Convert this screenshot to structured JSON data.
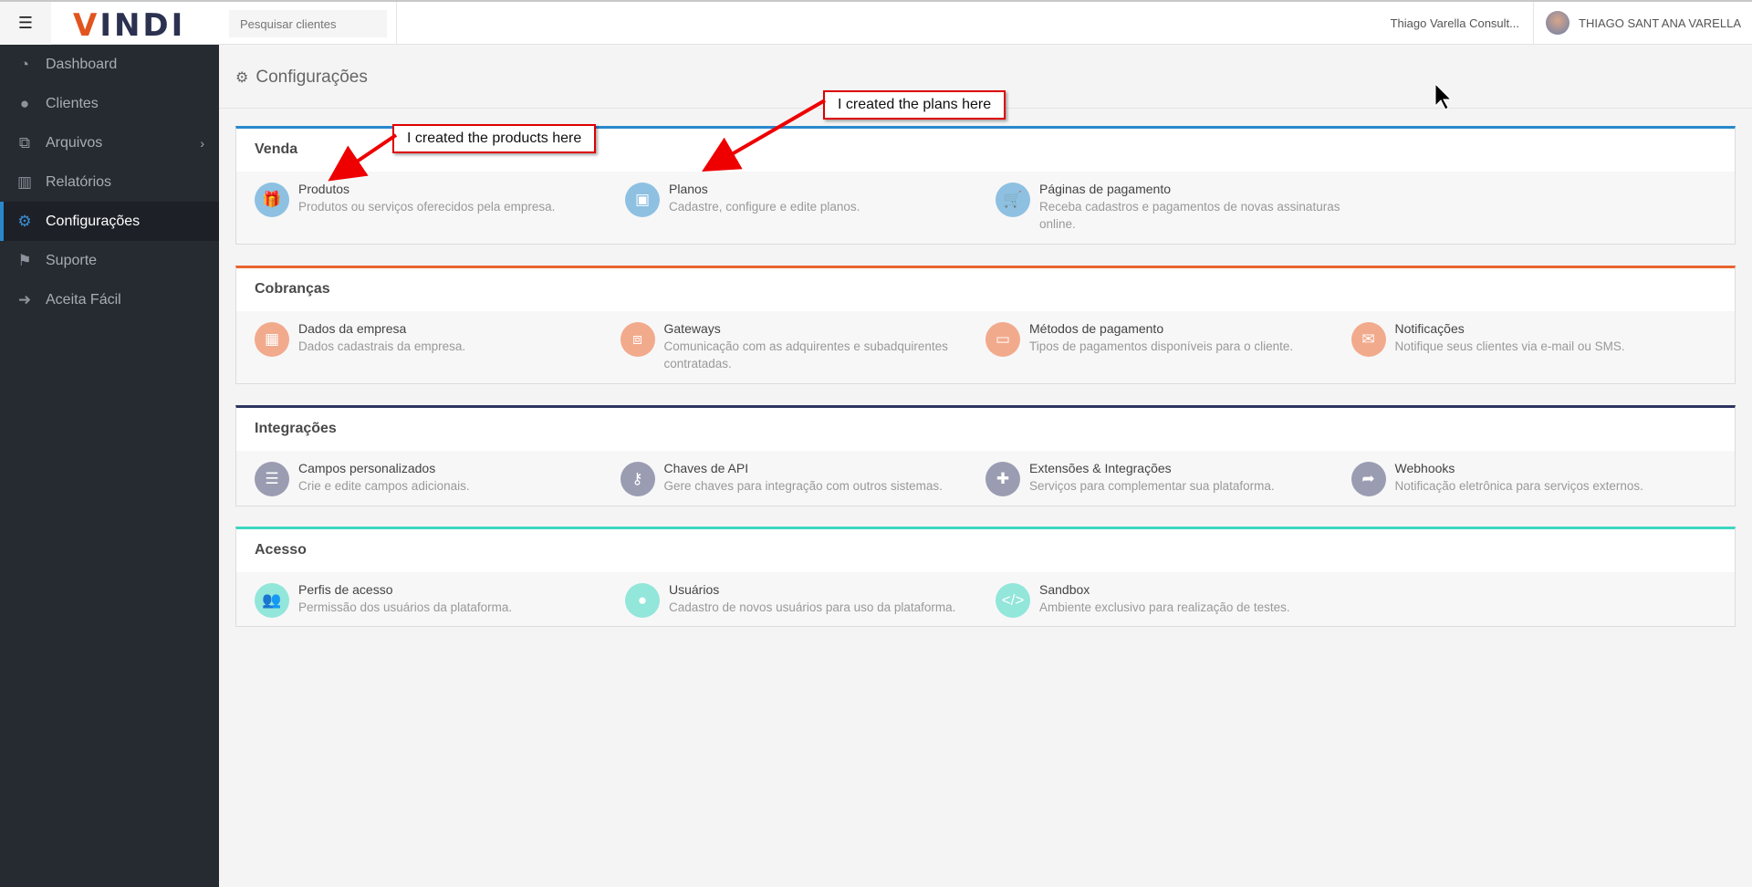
{
  "header": {
    "logo": "VINDI",
    "search_placeholder": "Pesquisar clientes",
    "company": "Thiago Varella Consult...",
    "user": "THIAGO SANT ANA VARELLA",
    "menu_icon": "☰"
  },
  "sidebar": {
    "items": [
      {
        "label": "Dashboard",
        "icon": "dashboard-icon",
        "glyph": "◔"
      },
      {
        "label": "Clientes",
        "icon": "user-icon",
        "glyph": "●"
      },
      {
        "label": "Arquivos",
        "icon": "files-icon",
        "glyph": "⧉"
      },
      {
        "label": "Relatórios",
        "icon": "bar-chart-icon",
        "glyph": "▥"
      },
      {
        "label": "Configurações",
        "icon": "gears-icon",
        "glyph": "⚙"
      },
      {
        "label": "Suporte",
        "icon": "flag-icon",
        "glyph": "⚑"
      },
      {
        "label": "Aceita Fácil",
        "icon": "sign-in-icon",
        "glyph": "➜"
      }
    ],
    "active": "Configurações"
  },
  "page": {
    "title": "Configurações"
  },
  "sections": [
    {
      "title": "Venda",
      "accent": "#2a88cc",
      "icon_color": "#8ec0e2",
      "items": [
        {
          "title": "Produtos",
          "desc": "Produtos ou serviços oferecidos pela empresa.",
          "icon": "gift-icon",
          "glyph": "🎁"
        },
        {
          "title": "Planos",
          "desc": "Cadastre, configure e edite planos.",
          "icon": "calendar-icon",
          "glyph": "▣"
        },
        {
          "title": "Páginas de pagamento",
          "desc": "Receba cadastros e pagamentos de novas assinaturas online.",
          "icon": "cart-icon",
          "glyph": "🛒"
        }
      ]
    },
    {
      "title": "Cobranças",
      "accent": "#e8642e",
      "icon_color": "#f2aa8c",
      "items": [
        {
          "title": "Dados da empresa",
          "desc": "Dados cadastrais da empresa.",
          "icon": "building-icon",
          "glyph": "▦"
        },
        {
          "title": "Gateways",
          "desc": "Comunicação com as adquirentes e subadquirentes contratadas.",
          "icon": "sitemap-icon",
          "glyph": "⧈"
        },
        {
          "title": "Métodos de pagamento",
          "desc": "Tipos de pagamentos disponíveis para o cliente.",
          "icon": "credit-card-icon",
          "glyph": "▭"
        },
        {
          "title": "Notificações",
          "desc": "Notifique seus clientes via e-mail ou SMS.",
          "icon": "envelope-icon",
          "glyph": "✉"
        }
      ]
    },
    {
      "title": "Integrações",
      "accent": "#2f3561",
      "icon_color": "#9a9cb2",
      "items": [
        {
          "title": "Campos personalizados",
          "desc": "Crie e edite campos adicionais.",
          "icon": "table-icon",
          "glyph": "☰"
        },
        {
          "title": "Chaves de API",
          "desc": "Gere chaves para integração com outros sistemas.",
          "icon": "key-icon",
          "glyph": "⚷"
        },
        {
          "title": "Extensões & Integrações",
          "desc": "Serviços para complementar sua plataforma.",
          "icon": "puzzle-icon",
          "glyph": "✚"
        },
        {
          "title": "Webhooks",
          "desc": "Notificação eletrônica para serviços externos.",
          "icon": "share-icon",
          "glyph": "➦"
        }
      ]
    },
    {
      "title": "Acesso",
      "accent": "#3dd6c0",
      "icon_color": "#92e6da",
      "items": [
        {
          "title": "Perfis de acesso",
          "desc": "Permissão dos usuários da plataforma.",
          "icon": "users-icon",
          "glyph": "👥"
        },
        {
          "title": "Usuários",
          "desc": "Cadastro de novos usuários para uso da plataforma.",
          "icon": "user-icon",
          "glyph": "●"
        },
        {
          "title": "Sandbox",
          "desc": "Ambiente exclusivo para realização de testes.",
          "icon": "code-icon",
          "glyph": "</>"
        }
      ]
    }
  ],
  "annotations": {
    "products": "I created the products here",
    "plans": "I created the plans here"
  }
}
